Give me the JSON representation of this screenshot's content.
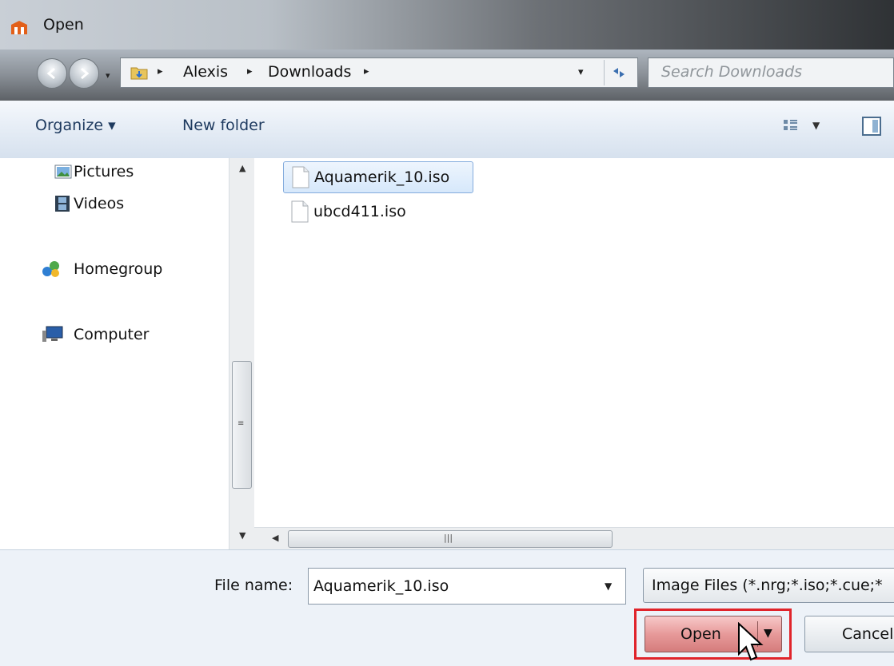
{
  "window": {
    "title": "Open",
    "icon": "nero-app-icon"
  },
  "address_bar": {
    "crumbs": [
      "Alexis",
      "Downloads"
    ],
    "search_placeholder": "Search Downloads"
  },
  "command_bar": {
    "organize_label": "Organize ▾",
    "new_folder_label": "New folder"
  },
  "nav_pane": {
    "items": [
      {
        "label": "Pictures",
        "icon": "pictures-icon"
      },
      {
        "label": "Videos",
        "icon": "videos-icon"
      },
      {
        "label": "Homegroup",
        "icon": "homegroup-icon"
      },
      {
        "label": "Computer",
        "icon": "computer-icon"
      }
    ]
  },
  "files": [
    {
      "name": "Aquamerik_10.iso",
      "selected": true
    },
    {
      "name": "ubcd411.iso",
      "selected": false
    }
  ],
  "footer": {
    "file_name_label": "File name:",
    "file_name_value": "Aquamerik_10.iso",
    "filter_value": "Image Files (*.nrg;*.iso;*.cue;*",
    "open_label": "Open",
    "cancel_label": "Cancel"
  },
  "colors": {
    "highlight_border": "#e0242b",
    "open_button": "#e79a9a"
  }
}
